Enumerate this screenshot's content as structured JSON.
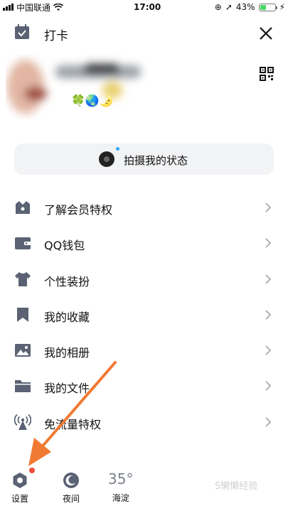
{
  "status_bar": {
    "carrier": "中国联通",
    "time": "17:00",
    "battery_percent": "43%",
    "battery_level": 0.43
  },
  "header": {
    "checkin_label": "打卡"
  },
  "profile": {
    "name_blurred": true,
    "emoji_badges": "🍀🌏🌛"
  },
  "status_pill": {
    "label": "拍摄我的状态"
  },
  "menu": [
    {
      "label": "了解会员特权",
      "icon": "vip-crown-icon"
    },
    {
      "label": "QQ钱包",
      "icon": "wallet-icon"
    },
    {
      "label": "个性装扮",
      "icon": "tshirt-icon"
    },
    {
      "label": "我的收藏",
      "icon": "bookmark-icon"
    },
    {
      "label": "我的相册",
      "icon": "photo-icon"
    },
    {
      "label": "我的文件",
      "icon": "folder-icon"
    },
    {
      "label": "免流量特权",
      "icon": "broadcast-icon"
    }
  ],
  "bottom": {
    "settings_label": "设置",
    "night_label": "夜间",
    "temperature": "35°",
    "city": "海淀"
  },
  "watermark": "S懒懒经验",
  "colors": {
    "icon": "#5a6273",
    "pill_bg": "#f2f3f5",
    "arrow": "#f07a32",
    "badge": "#f04c3c"
  }
}
